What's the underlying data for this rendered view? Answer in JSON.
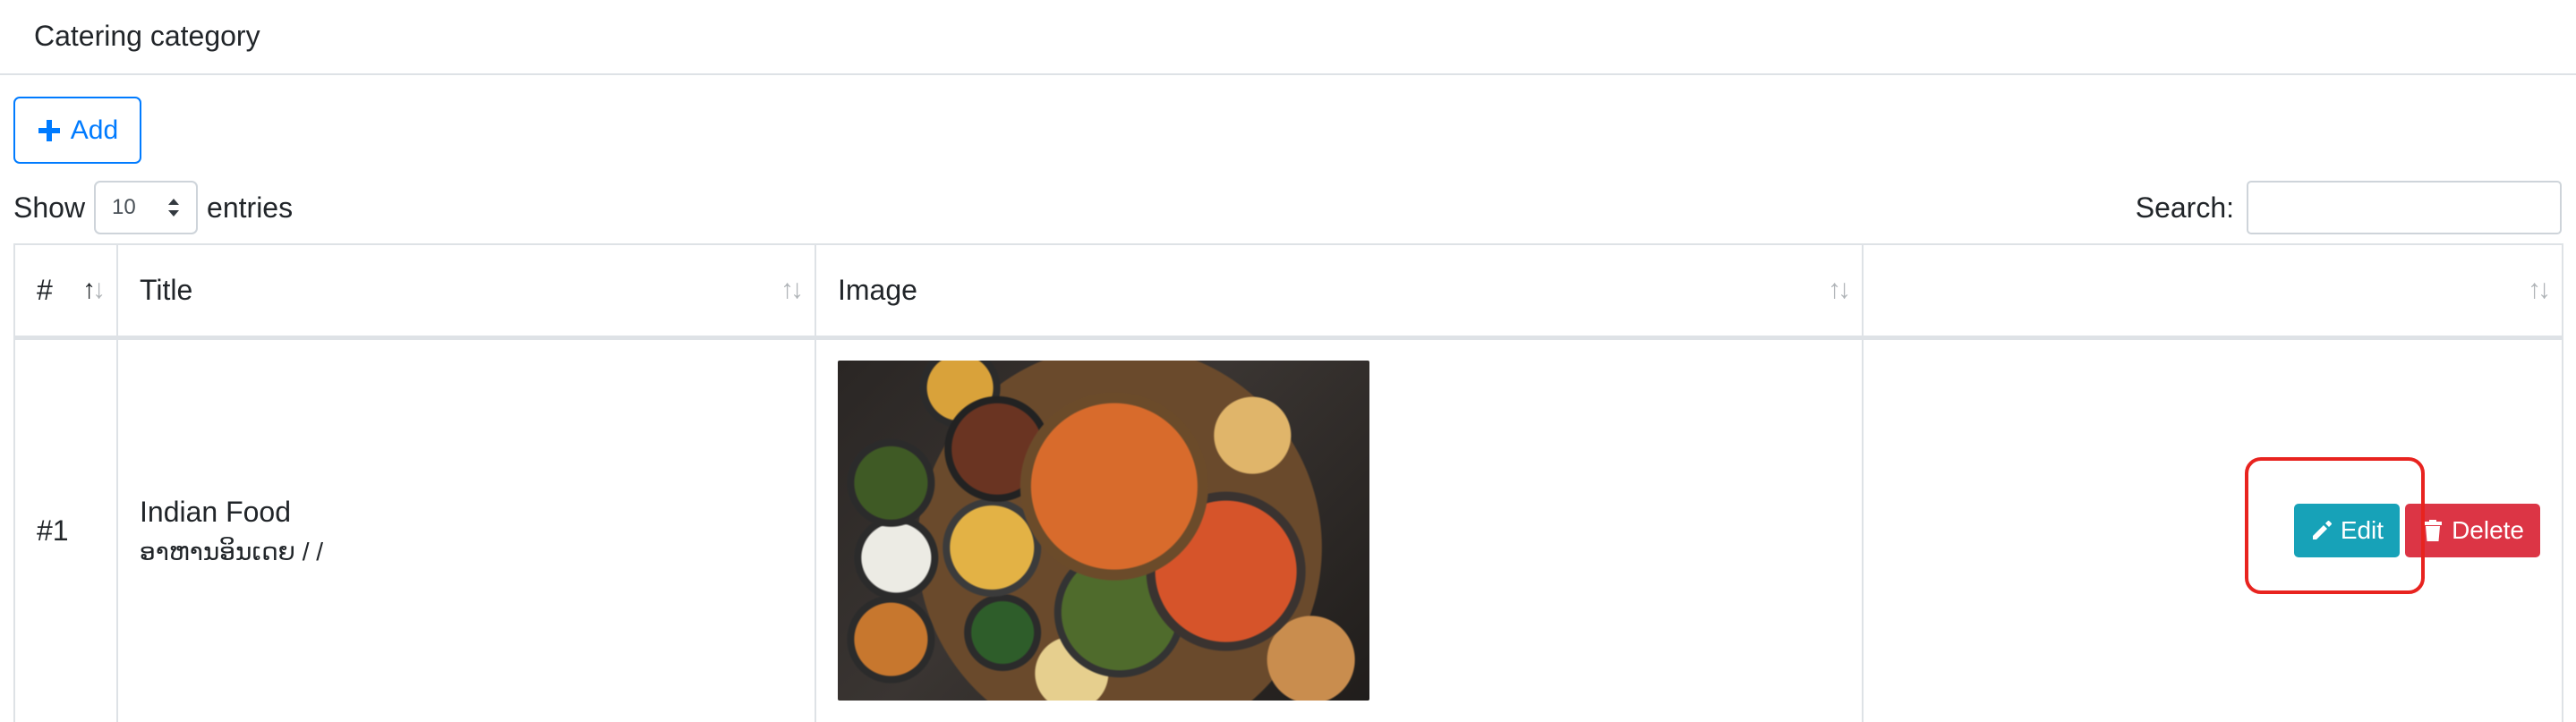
{
  "header": {
    "title": "Catering category"
  },
  "toolbar": {
    "add_label": "Add"
  },
  "length": {
    "prefix": "Show",
    "value": "10",
    "suffix": "entries"
  },
  "search": {
    "label": "Search:",
    "value": "",
    "placeholder": ""
  },
  "table": {
    "columns": [
      "#",
      "Title",
      "Image",
      ""
    ],
    "rows": [
      {
        "id": "#1",
        "title": "Indian Food",
        "subtitle": "ອາຫານອິນເດຍ / /",
        "edit_label": "Edit",
        "delete_label": "Delete"
      }
    ]
  },
  "colors": {
    "primary": "#007bff",
    "edit": "#17a2b8",
    "delete": "#dc3545",
    "highlight": "#e8231f"
  },
  "icons": {
    "add": "plus-icon",
    "edit": "pencil-icon",
    "delete": "trash-icon",
    "sort": "sort-arrows-icon",
    "select": "select-caret-icon"
  }
}
